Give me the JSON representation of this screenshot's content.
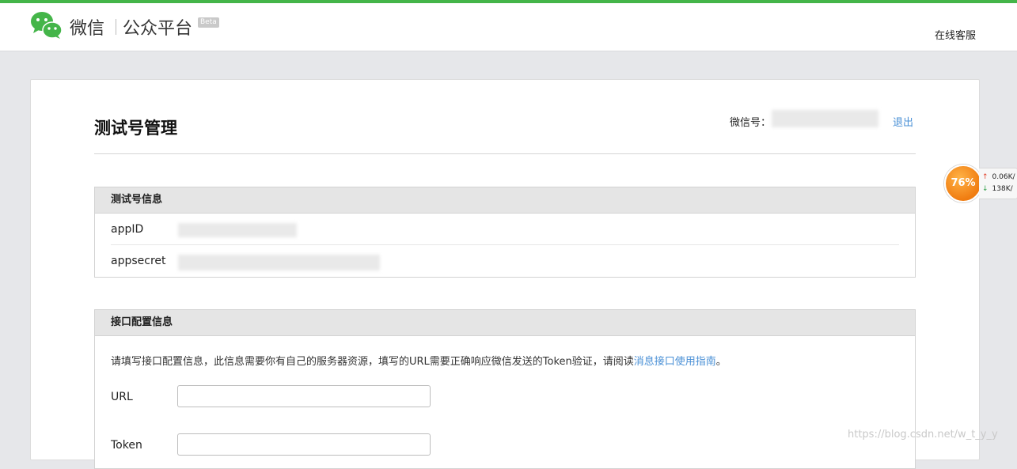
{
  "header": {
    "brand_name": "微信",
    "brand_platform": "公众平台",
    "beta": "Beta",
    "support_link": "在线客服"
  },
  "page": {
    "title": "测试号管理",
    "account_label": "微信号：",
    "logout": "退出"
  },
  "test_account": {
    "heading": "测试号信息",
    "rows": [
      {
        "key": "appID"
      },
      {
        "key": "appsecret"
      }
    ]
  },
  "interface_config": {
    "heading": "接口配置信息",
    "description": "请填写接口配置信息，此信息需要你有自己的服务器资源，填写的URL需要正确响应微信发送的Token验证，请阅读",
    "guide_link": "消息接口使用指南",
    "description_end": "。",
    "fields": [
      {
        "label": "URL",
        "value": ""
      },
      {
        "label": "Token",
        "value": ""
      }
    ]
  },
  "net_widget": {
    "percent": "76%",
    "upload": "0.06K/",
    "download": "138K/"
  },
  "watermark": "https://blog.csdn.net/w_t_y_y",
  "colors": {
    "brand_green": "#44b549",
    "link_blue": "#4a90d6",
    "widget_orange": "#f07c10"
  }
}
